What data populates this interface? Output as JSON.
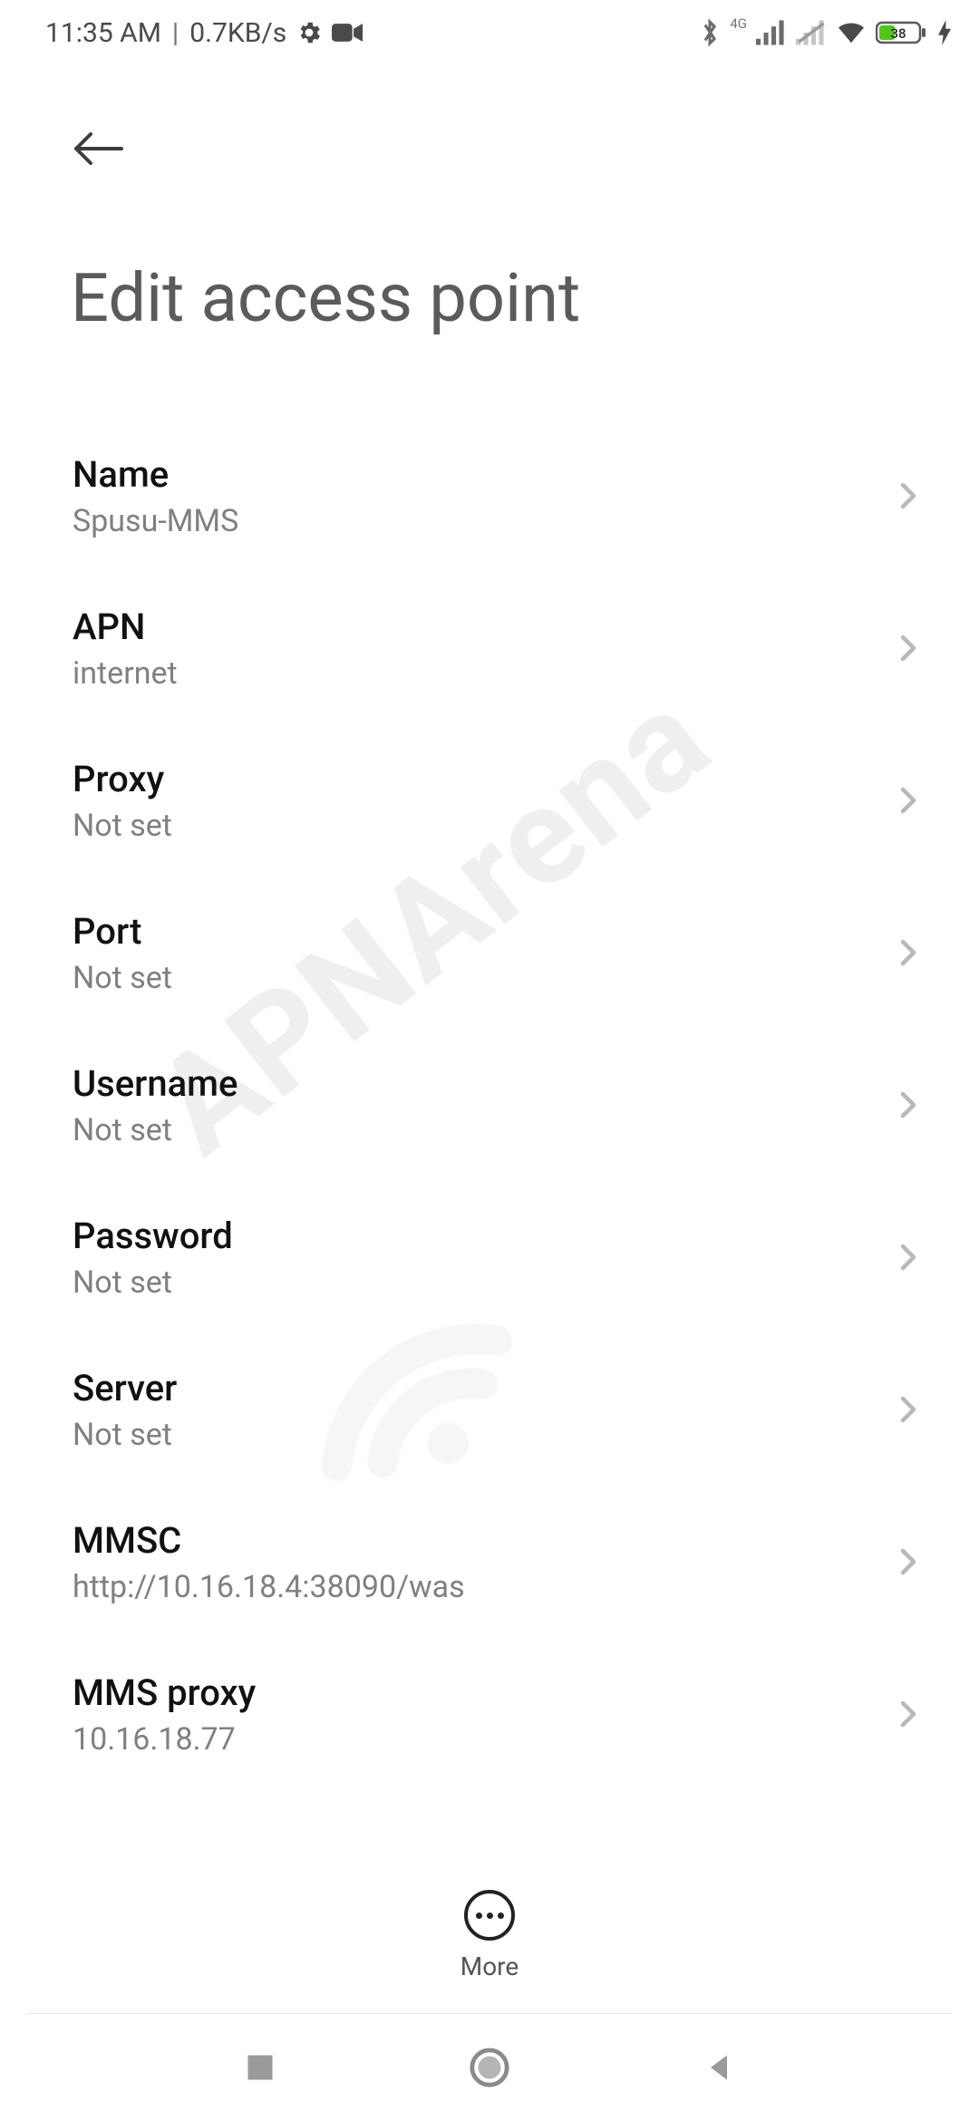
{
  "status": {
    "time": "11:35 AM",
    "net_speed": "0.7KB/s",
    "net_label": "4G",
    "battery_pct": "38"
  },
  "header": {
    "title": "Edit access point"
  },
  "rows": [
    {
      "title": "Name",
      "sub": "Spusu-MMS"
    },
    {
      "title": "APN",
      "sub": "internet"
    },
    {
      "title": "Proxy",
      "sub": "Not set"
    },
    {
      "title": "Port",
      "sub": "Not set"
    },
    {
      "title": "Username",
      "sub": "Not set"
    },
    {
      "title": "Password",
      "sub": "Not set"
    },
    {
      "title": "Server",
      "sub": "Not set"
    },
    {
      "title": "MMSC",
      "sub": "http://10.16.18.4:38090/was"
    },
    {
      "title": "MMS proxy",
      "sub": "10.16.18.77"
    }
  ],
  "footer": {
    "more_label": "More"
  },
  "watermark": "APNArena"
}
